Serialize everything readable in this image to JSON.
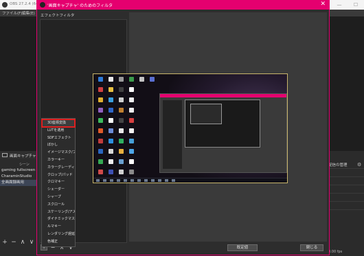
{
  "obs": {
    "title": "OBS 27.2.4 (64",
    "menu": [
      "ファイル(F)",
      "編集(E)"
    ],
    "window_buttons": [
      "—",
      "☐"
    ],
    "dock_title": "画面キャプチャ",
    "scenes_header": "シーン",
    "scenes": [
      "gaming fullscreen",
      "CharaminStudio",
      "全画面録画用"
    ],
    "selected_scene_index": 2,
    "scene_toolbar": [
      "+",
      "−",
      "∧",
      "∨"
    ],
    "right_dock_header": "配信の管理",
    "gear": "⚙",
    "fps": "0.00 fps"
  },
  "dialog": {
    "title": "'画面キャプチャ' のためのフィルタ",
    "close_glyph": "✕",
    "effects_label": "エフェクトフィルタ",
    "toolbar": [
      "+",
      "−",
      "∧",
      "∨"
    ],
    "defaults_button": "既定値",
    "close_button": "閉じる",
    "accent_color": "#e5006f"
  },
  "context_menu": {
    "items": [
      "3D座標変換",
      "LUTを適用",
      "SDFエフェクト",
      "ぼかし",
      "イメージマスク/ブレンド",
      "カラーキー",
      "カラーグレーディング",
      "クロップ/パッド",
      "クロマキー",
      "シェーダー",
      "シャープ",
      "スクロール",
      "スケーリング/アスペクト比",
      "ダイナミックマスク",
      "ルマキー",
      "レンダリング遅延",
      "色補正"
    ],
    "highlighted_index": 0
  }
}
